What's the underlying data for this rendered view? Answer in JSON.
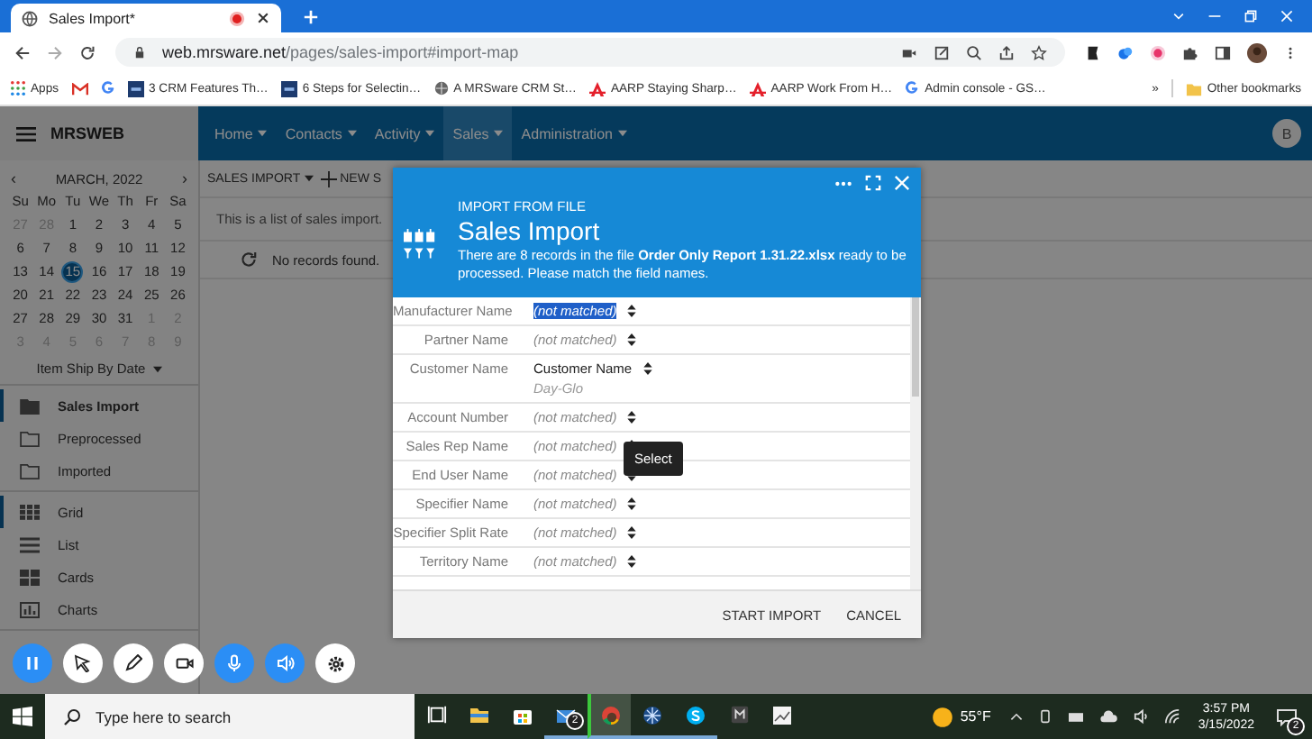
{
  "browser": {
    "tab": {
      "title": "Sales Import*",
      "recording": true
    },
    "url": {
      "domain": "web.mrsware.net",
      "path": "/pages/sales-import#import-map"
    },
    "bookmarks": [
      {
        "kind": "apps",
        "label": "Apps"
      },
      {
        "kind": "gmail"
      },
      {
        "kind": "google"
      },
      {
        "kind": "crm",
        "label": "3 CRM Features Th…"
      },
      {
        "kind": "crm",
        "label": "6 Steps for Selectin…"
      },
      {
        "kind": "globe",
        "label": "A MRSware CRM St…"
      },
      {
        "kind": "aarp",
        "label": "AARP Staying Sharp…"
      },
      {
        "kind": "aarp",
        "label": "AARP Work From H…"
      },
      {
        "kind": "google",
        "label": "Admin console - GS…"
      }
    ],
    "more": "»",
    "other_bookmarks": "Other bookmarks"
  },
  "app": {
    "brand": "MRSWEB",
    "nav": [
      {
        "label": "Home",
        "selected": false
      },
      {
        "label": "Contacts",
        "selected": false
      },
      {
        "label": "Activity",
        "selected": false
      },
      {
        "label": "Sales",
        "selected": true
      },
      {
        "label": "Administration",
        "selected": false
      }
    ],
    "user_initial": "B",
    "calendar": {
      "month": "MARCH, 2022",
      "prev": "‹",
      "next": "›",
      "weekdays": [
        "Su",
        "Mo",
        "Tu",
        "We",
        "Th",
        "Fr",
        "Sa"
      ],
      "weeks": [
        [
          {
            "day": "27",
            "muted": true,
            "selected": false
          },
          {
            "day": "28",
            "muted": true,
            "selected": false
          },
          {
            "day": "1",
            "muted": false,
            "selected": false
          },
          {
            "day": "2",
            "muted": false,
            "selected": false
          },
          {
            "day": "3",
            "muted": false,
            "selected": false
          },
          {
            "day": "4",
            "muted": false,
            "selected": false
          },
          {
            "day": "5",
            "muted": false,
            "selected": false
          }
        ],
        [
          {
            "day": "6",
            "muted": false,
            "selected": false
          },
          {
            "day": "7",
            "muted": false,
            "selected": false
          },
          {
            "day": "8",
            "muted": false,
            "selected": false
          },
          {
            "day": "9",
            "muted": false,
            "selected": false
          },
          {
            "day": "10",
            "muted": false,
            "selected": false
          },
          {
            "day": "11",
            "muted": false,
            "selected": false
          },
          {
            "day": "12",
            "muted": false,
            "selected": false
          }
        ],
        [
          {
            "day": "13",
            "muted": false,
            "selected": false
          },
          {
            "day": "14",
            "muted": false,
            "selected": false
          },
          {
            "day": "15",
            "muted": false,
            "selected": true
          },
          {
            "day": "16",
            "muted": false,
            "selected": false
          },
          {
            "day": "17",
            "muted": false,
            "selected": false
          },
          {
            "day": "18",
            "muted": false,
            "selected": false
          },
          {
            "day": "19",
            "muted": false,
            "selected": false
          }
        ],
        [
          {
            "day": "20",
            "muted": false,
            "selected": false
          },
          {
            "day": "21",
            "muted": false,
            "selected": false
          },
          {
            "day": "22",
            "muted": false,
            "selected": false
          },
          {
            "day": "23",
            "muted": false,
            "selected": false
          },
          {
            "day": "24",
            "muted": false,
            "selected": false
          },
          {
            "day": "25",
            "muted": false,
            "selected": false
          },
          {
            "day": "26",
            "muted": false,
            "selected": false
          }
        ],
        [
          {
            "day": "27",
            "muted": false,
            "selected": false
          },
          {
            "day": "28",
            "muted": false,
            "selected": false
          },
          {
            "day": "29",
            "muted": false,
            "selected": false
          },
          {
            "day": "30",
            "muted": false,
            "selected": false
          },
          {
            "day": "31",
            "muted": false,
            "selected": false
          },
          {
            "day": "1",
            "muted": true,
            "selected": false
          },
          {
            "day": "2",
            "muted": true,
            "selected": false
          }
        ],
        [
          {
            "day": "3",
            "muted": true,
            "selected": false
          },
          {
            "day": "4",
            "muted": true,
            "selected": false
          },
          {
            "day": "5",
            "muted": true,
            "selected": false
          },
          {
            "day": "6",
            "muted": true,
            "selected": false
          },
          {
            "day": "7",
            "muted": true,
            "selected": false
          },
          {
            "day": "8",
            "muted": true,
            "selected": false
          },
          {
            "day": "9",
            "muted": true,
            "selected": false
          }
        ]
      ],
      "date_field": "Item Ship By Date"
    },
    "folders": [
      {
        "label": "Sales Import",
        "selected": true
      },
      {
        "label": "Preprocessed",
        "selected": false
      },
      {
        "label": "Imported",
        "selected": false
      }
    ],
    "views": [
      {
        "kind": "grid",
        "label": "Grid",
        "selected": true
      },
      {
        "kind": "list",
        "label": "List",
        "selected": false
      },
      {
        "kind": "cards",
        "label": "Cards",
        "selected": false
      },
      {
        "kind": "charts",
        "label": "Charts",
        "selected": false
      }
    ],
    "toolbar": {
      "title": "SALES IMPORT",
      "new": "NEW S"
    },
    "description": "This is a list of sales import.",
    "empty": "No records found."
  },
  "dialog": {
    "eyebrow": "IMPORT FROM FILE",
    "title": "Sales Import",
    "message": "There are 8 records in the file **Order Only Report 1.31.22.xlsx** ready to be processed. Please match the field names.",
    "fields": [
      {
        "label": "Manufacturer Name",
        "value": "(not matched)",
        "matched": false,
        "selected": true
      },
      {
        "label": "Partner Name",
        "value": "(not matched)",
        "matched": false,
        "selected": false
      },
      {
        "label": "Customer Name",
        "value": "Customer Name",
        "sample": "Day-Glo",
        "matched": true,
        "selected": false
      },
      {
        "label": "Account Number",
        "value": "(not matched)",
        "matched": false,
        "selected": false
      },
      {
        "label": "Sales Rep Name",
        "value": "(not matched)",
        "matched": false,
        "selected": false
      },
      {
        "label": "End User Name",
        "value": "(not matched)",
        "matched": false,
        "selected": false
      },
      {
        "label": "Specifier Name",
        "value": "(not matched)",
        "matched": false,
        "selected": false
      },
      {
        "label": "Specifier Split Rate",
        "value": "(not matched)",
        "matched": false,
        "selected": false
      },
      {
        "label": "Territory Name",
        "value": "(not matched)",
        "matched": false,
        "selected": false
      }
    ],
    "tooltip": "Select",
    "buttons": [
      "START IMPORT",
      "CANCEL"
    ]
  },
  "recorder": [
    {
      "kind": "pause",
      "active": true
    },
    {
      "kind": "pointer",
      "active": false
    },
    {
      "kind": "pen",
      "active": false
    },
    {
      "kind": "camera",
      "active": false
    },
    {
      "kind": "mic",
      "active": true
    },
    {
      "kind": "speaker",
      "active": true
    },
    {
      "kind": "settings",
      "active": false
    }
  ],
  "taskbar": {
    "search": "Type here to search",
    "apps": [
      {
        "kind": "task-view",
        "running": false,
        "active": false
      },
      {
        "kind": "folder",
        "running": false,
        "active": false
      },
      {
        "kind": "store",
        "running": false,
        "active": false
      },
      {
        "kind": "mail",
        "badge": "2",
        "running": true,
        "active": false
      },
      {
        "kind": "chrome",
        "running": true,
        "active": true
      },
      {
        "kind": "compass",
        "running": true,
        "active": false
      },
      {
        "kind": "skype",
        "running": true,
        "active": false
      },
      {
        "kind": "m-app",
        "running": false,
        "active": false
      },
      {
        "kind": "chart",
        "running": false,
        "active": false
      }
    ],
    "weather": "55°F",
    "time": "3:57 PM",
    "date": "3/15/2022",
    "notifications": "2"
  }
}
